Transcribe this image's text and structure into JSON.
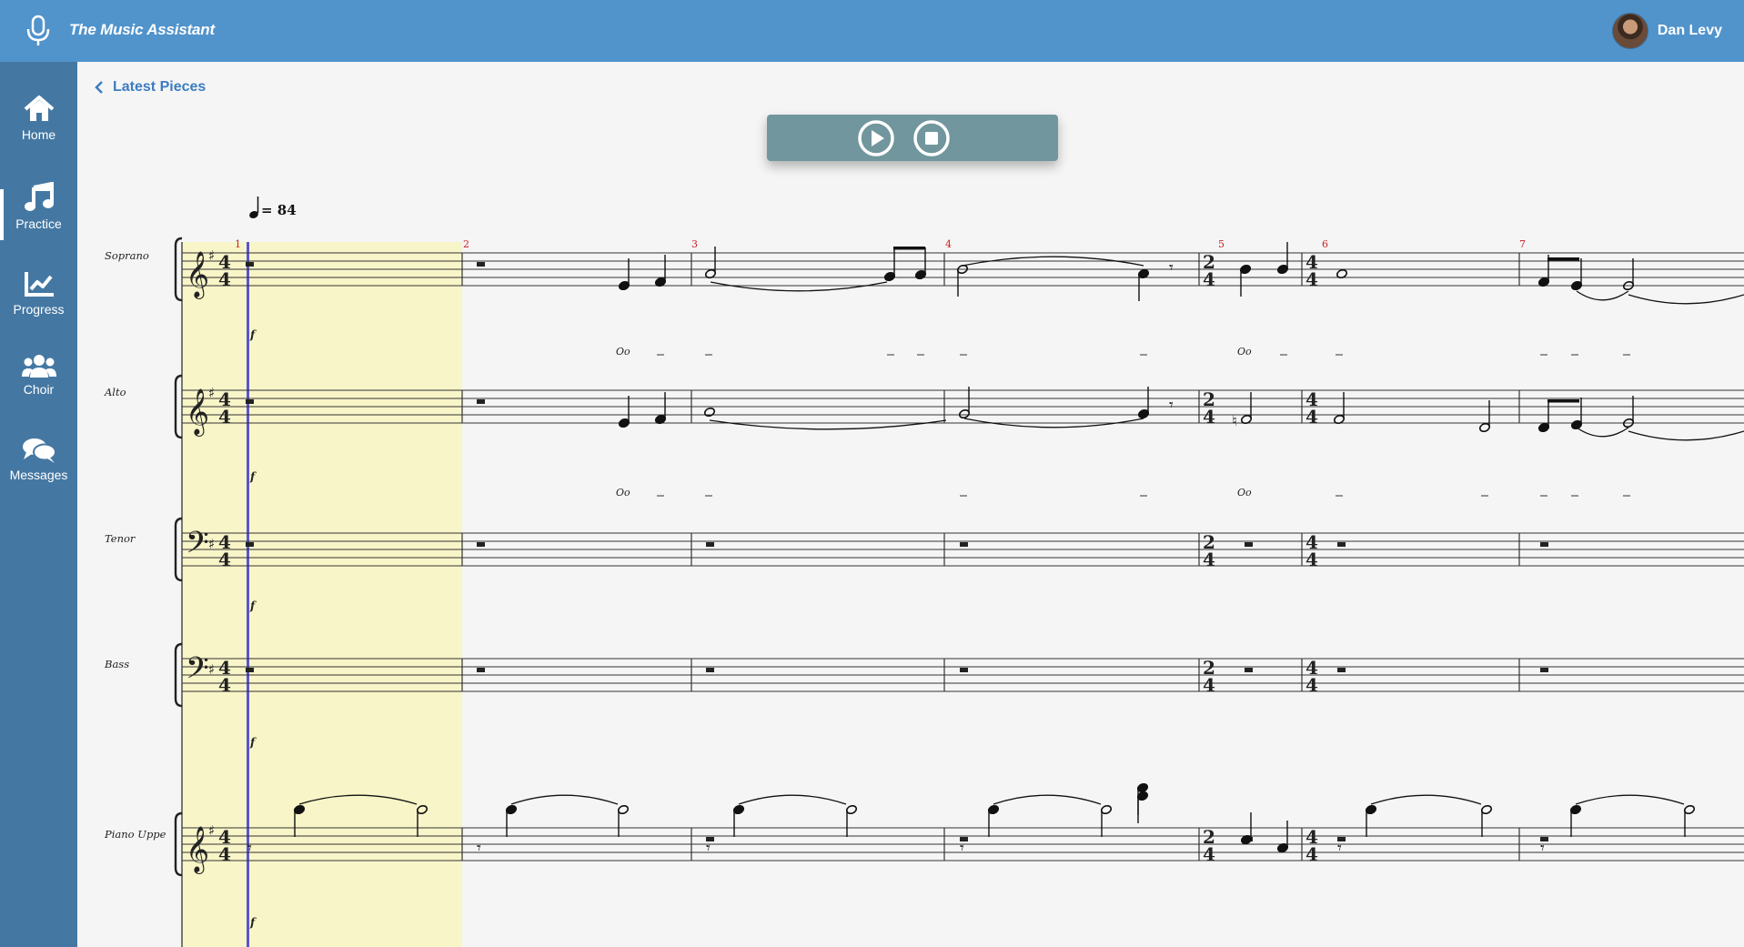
{
  "app": {
    "title": "The Music Assistant",
    "user_name": "Dan Levy"
  },
  "sidebar": {
    "items": [
      {
        "label": "Home",
        "icon": "home-icon",
        "active": false
      },
      {
        "label": "Practice",
        "icon": "music-note-icon",
        "active": true
      },
      {
        "label": "Progress",
        "icon": "chart-icon",
        "active": false
      },
      {
        "label": "Choir",
        "icon": "users-icon",
        "active": false
      },
      {
        "label": "Messages",
        "icon": "chat-bubbles-icon",
        "active": false
      }
    ]
  },
  "breadcrumb": {
    "back_label": "Latest Pieces"
  },
  "player": {
    "play_icon": "play-icon",
    "stop_icon": "stop-icon"
  },
  "score": {
    "tempo": "= 84",
    "parts": [
      "Soprano",
      "Alto",
      "Tenor",
      "Bass",
      "Piano Uppe"
    ],
    "measure_numbers": [
      "1",
      "2",
      "3",
      "4",
      "5",
      "6",
      "7"
    ],
    "dynamics": "f",
    "lyric": "Oo",
    "highlight_color": "#f8f5c8",
    "cursor_color": "#5a55cc",
    "measure_number_color": "#cc2222"
  }
}
